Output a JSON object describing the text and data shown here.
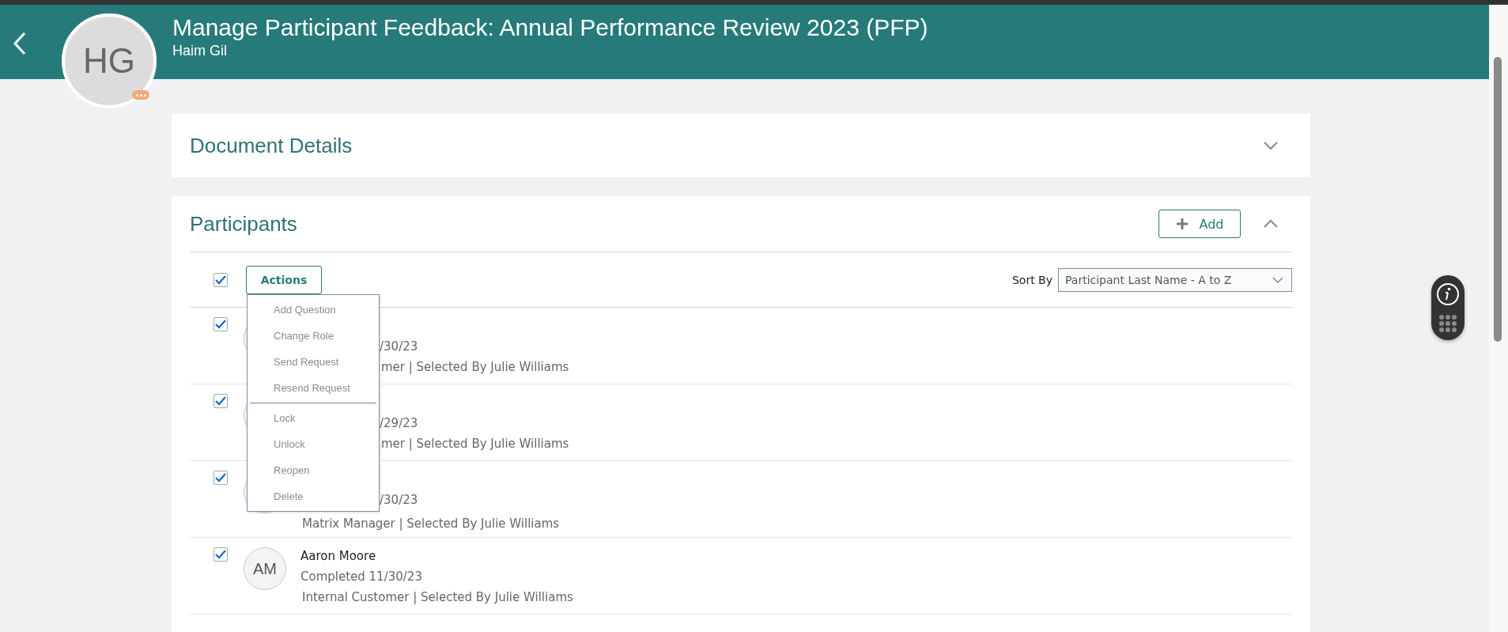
{
  "header": {
    "title": "Manage Participant Feedback: Annual Performance Review 2023 (PFP)",
    "subtitle": "Haim Gil",
    "avatar_initials": "HG"
  },
  "document_details": {
    "title": "Document Details",
    "expanded": false
  },
  "participants": {
    "title": "Participants",
    "expanded": true,
    "add_button": "Add",
    "select_all": {
      "checked": true
    },
    "actions_button": "Actions",
    "actions_menu": [
      {
        "label": "Add Question",
        "disabled": true
      },
      {
        "label": "Change Role",
        "disabled": true
      },
      {
        "label": "Send Request",
        "disabled": true
      },
      {
        "label": "Resend Request",
        "disabled": true,
        "divider_after": true
      },
      {
        "label": "Lock",
        "disabled": true
      },
      {
        "label": "Unlock",
        "disabled": true
      },
      {
        "label": "Reopen",
        "disabled": true
      },
      {
        "label": "Delete",
        "disabled": true
      }
    ],
    "sort_label": "Sort By",
    "sort_value": "Participant Last Name - A to Z",
    "rows": [
      {
        "kind": "covered",
        "checked": true,
        "status": "/30/23",
        "detail": "mer | Selected By Julie Williams"
      },
      {
        "kind": "covered",
        "checked": true,
        "status": "/29/23",
        "detail": "mer | Selected By Julie Williams"
      },
      {
        "kind": "covered",
        "checked": true,
        "status": "/30/23",
        "detail": "Matrix Manager | Selected By Julie Williams"
      },
      {
        "kind": "full",
        "checked": true,
        "initials": "AM",
        "name": "Aaron Moore",
        "status": "Completed 11/30/23",
        "detail": "Internal Customer | Selected By Julie Williams"
      }
    ]
  }
}
